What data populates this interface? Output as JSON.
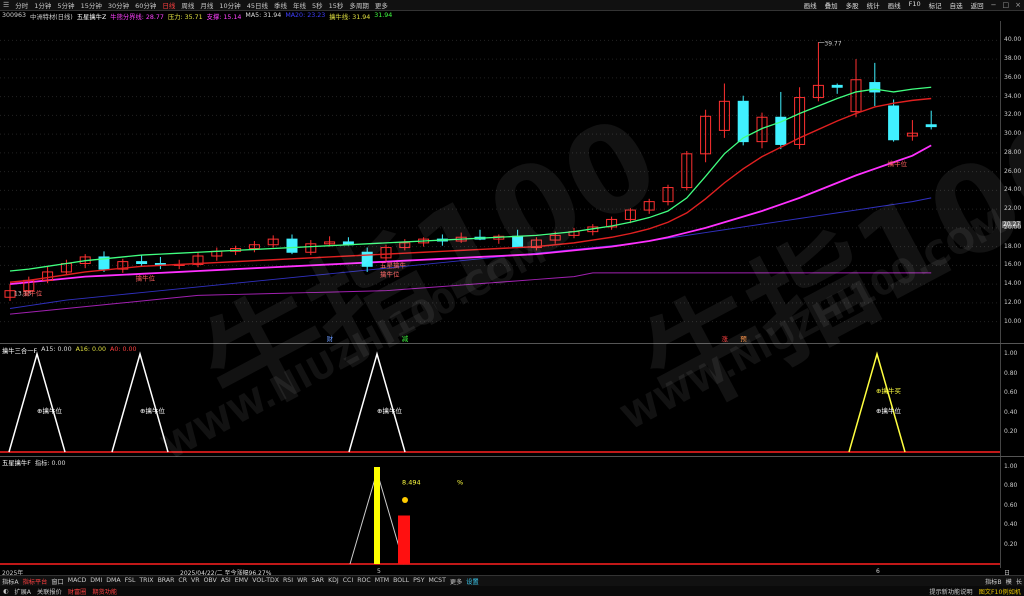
{
  "toolbar": {
    "menu_glyph": "☰",
    "timeframes": [
      "分时",
      "1分钟",
      "5分钟",
      "15分钟",
      "30分钟",
      "60分钟",
      "日线",
      "周线",
      "月线",
      "10分钟",
      "45日线",
      "季线",
      "年线",
      "5秒",
      "15秒",
      "多周期",
      "更多"
    ],
    "active_timeframe": "日线",
    "right_buttons": [
      "画线",
      "叠加",
      "多股",
      "统计",
      "画线",
      "F10",
      "标记",
      "自选",
      "返回"
    ]
  },
  "stock": {
    "code": "300963",
    "name": "中洲特材(日线)"
  },
  "legend_main": {
    "indicator_name": "五星擒牛Z",
    "items": [
      {
        "label": "牛熊分界线: 28.77",
        "color": "#ff40ff"
      },
      {
        "label": "压力: 35.71",
        "color": "#e0e040"
      },
      {
        "label": "支撑: 15.14",
        "color": "#ff40ff"
      },
      {
        "label": "MA5: 31.94",
        "color": "#dddddd"
      },
      {
        "label": "MA20: 23.23",
        "color": "#3f3fff"
      },
      {
        "label": "擒牛线: 31.94",
        "color": "#e0e040"
      },
      {
        "label": "31.94",
        "color": "#40ff40"
      }
    ]
  },
  "price_axis": {
    "ticks": [
      "40.00",
      "38.00",
      "36.00",
      "34.00",
      "32.00",
      "30.00",
      "28.00",
      "26.00",
      "24.00",
      "22.00",
      "20.27",
      "20.00",
      "18.00",
      "16.00",
      "14.00",
      "12.00",
      "10.00"
    ],
    "current": "20.27"
  },
  "annotations": {
    "high": "39.77",
    "low": "13.13",
    "labels": [
      "擒牛位",
      "擒牛位",
      "擒牛位",
      "五星擒牛",
      "擒牛位"
    ],
    "markers": [
      "财",
      "减",
      "涨",
      "预"
    ]
  },
  "legend_sub1": {
    "name": "擒牛三合一F",
    "items": [
      {
        "label": "A15: 0.00",
        "color": "#dddddd"
      },
      {
        "label": "A16: 0.00",
        "color": "#e0e040"
      },
      {
        "label": "A0: 0.00",
        "color": "#ff4040"
      }
    ],
    "peak_labels": [
      "擒牛位",
      "擒牛位",
      "擒牛位",
      "擒牛位",
      "擒牛买"
    ]
  },
  "sub1_axis": {
    "ticks": [
      "1.00",
      "0.80",
      "0.60",
      "0.40",
      "0.20"
    ]
  },
  "legend_sub2": {
    "name": "五星擒牛F",
    "items": [
      {
        "label": "指标: 0.00",
        "color": "#dddddd"
      }
    ],
    "value_label": "8.494",
    "percent": "%"
  },
  "sub2_axis": {
    "ticks": [
      "1.00",
      "0.80",
      "0.60",
      "0.40",
      "0.20"
    ]
  },
  "time_axis": {
    "labels": [
      "2025年",
      "2025/04/22/二 至今涨幅96.27%",
      "5",
      "6"
    ],
    "right": "日线"
  },
  "bottom_indicators": [
    "指标A",
    "指标平台",
    "窗口",
    "MACD",
    "DMI",
    "DMA",
    "FSL",
    "TRIX",
    "BRAR",
    "CR",
    "VR",
    "OBV",
    "ASI",
    "EMV",
    "VOL-TDX",
    "RSI",
    "WR",
    "SAR",
    "KDJ",
    "CCI",
    "ROC",
    "MTM",
    "BOLL",
    "PSY",
    "MCST",
    "更多",
    "设置"
  ],
  "bottom_right": [
    "指标B",
    "模",
    "长"
  ],
  "status": {
    "items": [
      "扩展A",
      "关联报价",
      "财富圈",
      "期货功能"
    ],
    "right_text": "提示新功能说明",
    "right_tag": "图文F10例如机"
  },
  "watermark": {
    "top": "牛指100",
    "url": "WWW.NIUZHI100.COM"
  },
  "colors": {
    "up": "#ff3030",
    "down": "#40f0ff",
    "ma_green": "#40ff80",
    "ma_red": "#e02020",
    "magenta": "#ff30ff",
    "blue": "#3030c0",
    "purple": "#a020b0"
  },
  "candles": [
    [
      12.6,
      14.0,
      12.2,
      13.3
    ],
    [
      13.3,
      14.8,
      13.0,
      14.4
    ],
    [
      14.4,
      15.9,
      14.1,
      15.3
    ],
    [
      15.3,
      16.6,
      15.0,
      16.2
    ],
    [
      16.2,
      17.2,
      15.7,
      16.9
    ],
    [
      16.9,
      17.5,
      15.3,
      15.6
    ],
    [
      15.6,
      16.7,
      15.2,
      16.4
    ],
    [
      16.4,
      17.1,
      15.9,
      16.2
    ],
    [
      16.2,
      16.9,
      15.6,
      16.0
    ],
    [
      16.0,
      16.6,
      15.6,
      16.1
    ],
    [
      16.1,
      17.4,
      15.8,
      17.0
    ],
    [
      17.0,
      17.9,
      16.5,
      17.5
    ],
    [
      17.5,
      18.1,
      17.1,
      17.8
    ],
    [
      17.8,
      18.6,
      17.4,
      18.2
    ],
    [
      18.2,
      19.2,
      17.9,
      18.8
    ],
    [
      18.8,
      19.3,
      17.2,
      17.4
    ],
    [
      17.4,
      18.7,
      17.1,
      18.3
    ],
    [
      18.3,
      19.1,
      18.0,
      18.5
    ],
    [
      18.5,
      19.0,
      18.1,
      18.2
    ],
    [
      17.4,
      17.9,
      15.3,
      15.9
    ],
    [
      16.8,
      18.2,
      16.4,
      17.9
    ],
    [
      17.9,
      18.8,
      17.6,
      18.4
    ],
    [
      18.4,
      19.0,
      18.0,
      18.8
    ],
    [
      18.8,
      19.3,
      18.1,
      18.6
    ],
    [
      18.6,
      19.5,
      18.4,
      19.0
    ],
    [
      19.0,
      19.8,
      18.7,
      18.8
    ],
    [
      18.8,
      19.3,
      18.3,
      19.1
    ],
    [
      19.1,
      19.8,
      18.6,
      17.9
    ],
    [
      17.9,
      19.0,
      17.6,
      18.7
    ],
    [
      18.7,
      19.6,
      18.3,
      19.2
    ],
    [
      19.2,
      20.0,
      18.9,
      19.6
    ],
    [
      19.6,
      20.4,
      19.2,
      20.1
    ],
    [
      20.1,
      21.2,
      19.8,
      20.9
    ],
    [
      20.9,
      22.1,
      20.5,
      21.9
    ],
    [
      21.9,
      23.1,
      21.5,
      22.8
    ],
    [
      22.8,
      24.6,
      22.4,
      24.3
    ],
    [
      24.3,
      28.2,
      24.0,
      27.9
    ],
    [
      27.9,
      32.6,
      27.0,
      31.9
    ],
    [
      30.4,
      35.4,
      29.6,
      33.5
    ],
    [
      33.5,
      34.1,
      28.8,
      29.2
    ],
    [
      29.2,
      32.3,
      28.5,
      31.8
    ],
    [
      31.8,
      34.5,
      28.4,
      28.9
    ],
    [
      28.9,
      35.0,
      28.4,
      33.9
    ],
    [
      33.9,
      39.8,
      33.5,
      35.2
    ],
    [
      35.2,
      35.4,
      34.3,
      35.0
    ],
    [
      32.4,
      38.0,
      31.8,
      35.8
    ],
    [
      35.5,
      37.6,
      33.0,
      34.5
    ],
    [
      33.0,
      33.7,
      29.2,
      29.4
    ],
    [
      29.8,
      31.5,
      29.3,
      30.1
    ],
    [
      31.0,
      32.5,
      30.5,
      30.8
    ]
  ],
  "ma_short": [
    14.6,
    14.9,
    15.4,
    15.9,
    16.3,
    16.4,
    16.5,
    16.6,
    16.6,
    16.7,
    16.8,
    16.9,
    17.0,
    17.2,
    17.4,
    17.5,
    17.6,
    17.7,
    17.8,
    17.8,
    17.8,
    17.9,
    18.0,
    18.1,
    18.2,
    18.3,
    18.3,
    18.3,
    18.4,
    18.5,
    18.7,
    19.0,
    19.4,
    19.9,
    20.6,
    21.6,
    23.2,
    25.5,
    27.9,
    29.6,
    30.6,
    31.3,
    32.2,
    33.0,
    33.8,
    34.5,
    34.8,
    33.7,
    32.9,
    31.9
  ],
  "ma_mid": [
    14.2,
    14.4,
    14.7,
    15.0,
    15.3,
    15.5,
    15.7,
    15.9,
    16.0,
    16.1,
    16.2,
    16.3,
    16.4,
    16.5,
    16.6,
    16.7,
    16.8,
    16.9,
    17.0,
    17.1,
    17.2,
    17.3,
    17.4,
    17.5,
    17.6,
    17.7,
    17.8,
    17.9,
    18.0,
    18.2,
    18.4,
    18.7,
    19.0,
    19.4,
    19.9,
    20.6,
    21.6,
    23.1,
    24.8,
    26.3,
    27.6,
    28.6,
    29.6,
    30.5,
    31.4,
    32.2,
    32.9,
    33.3,
    33.6,
    33.8
  ],
  "ma_long": [
    14.0,
    14.2,
    14.4,
    14.6,
    14.8,
    14.9,
    15.0,
    15.1,
    15.2,
    15.3,
    15.4,
    15.5,
    15.6,
    15.7,
    15.8,
    15.9,
    16.0,
    16.1,
    16.2,
    16.3,
    16.4,
    16.5,
    16.6,
    16.7,
    16.8,
    16.9,
    17.0,
    17.1,
    17.2,
    17.4,
    17.6,
    17.8,
    18.0,
    18.3,
    18.6,
    19.0,
    19.5,
    20.0,
    20.6,
    21.2,
    21.8,
    22.5,
    23.2,
    24.0,
    24.8,
    25.6,
    26.3,
    27.0,
    27.7,
    28.8
  ],
  "ma_blue": [
    11.4,
    11.7,
    12.0,
    12.3,
    12.5,
    12.7,
    12.9,
    13.1,
    13.3,
    13.5,
    13.7,
    13.9,
    14.1,
    14.3,
    14.5,
    14.7,
    14.9,
    15.1,
    15.3,
    15.5,
    15.7,
    15.9,
    16.1,
    16.3,
    16.5,
    16.7,
    16.9,
    17.1,
    17.3,
    17.5,
    17.7,
    17.9,
    18.1,
    18.3,
    18.6,
    18.9,
    19.2,
    19.5,
    19.8,
    20.1,
    20.4,
    20.7,
    21.0,
    21.3,
    21.6,
    21.9,
    22.2,
    22.5,
    22.8,
    23.2
  ]
}
